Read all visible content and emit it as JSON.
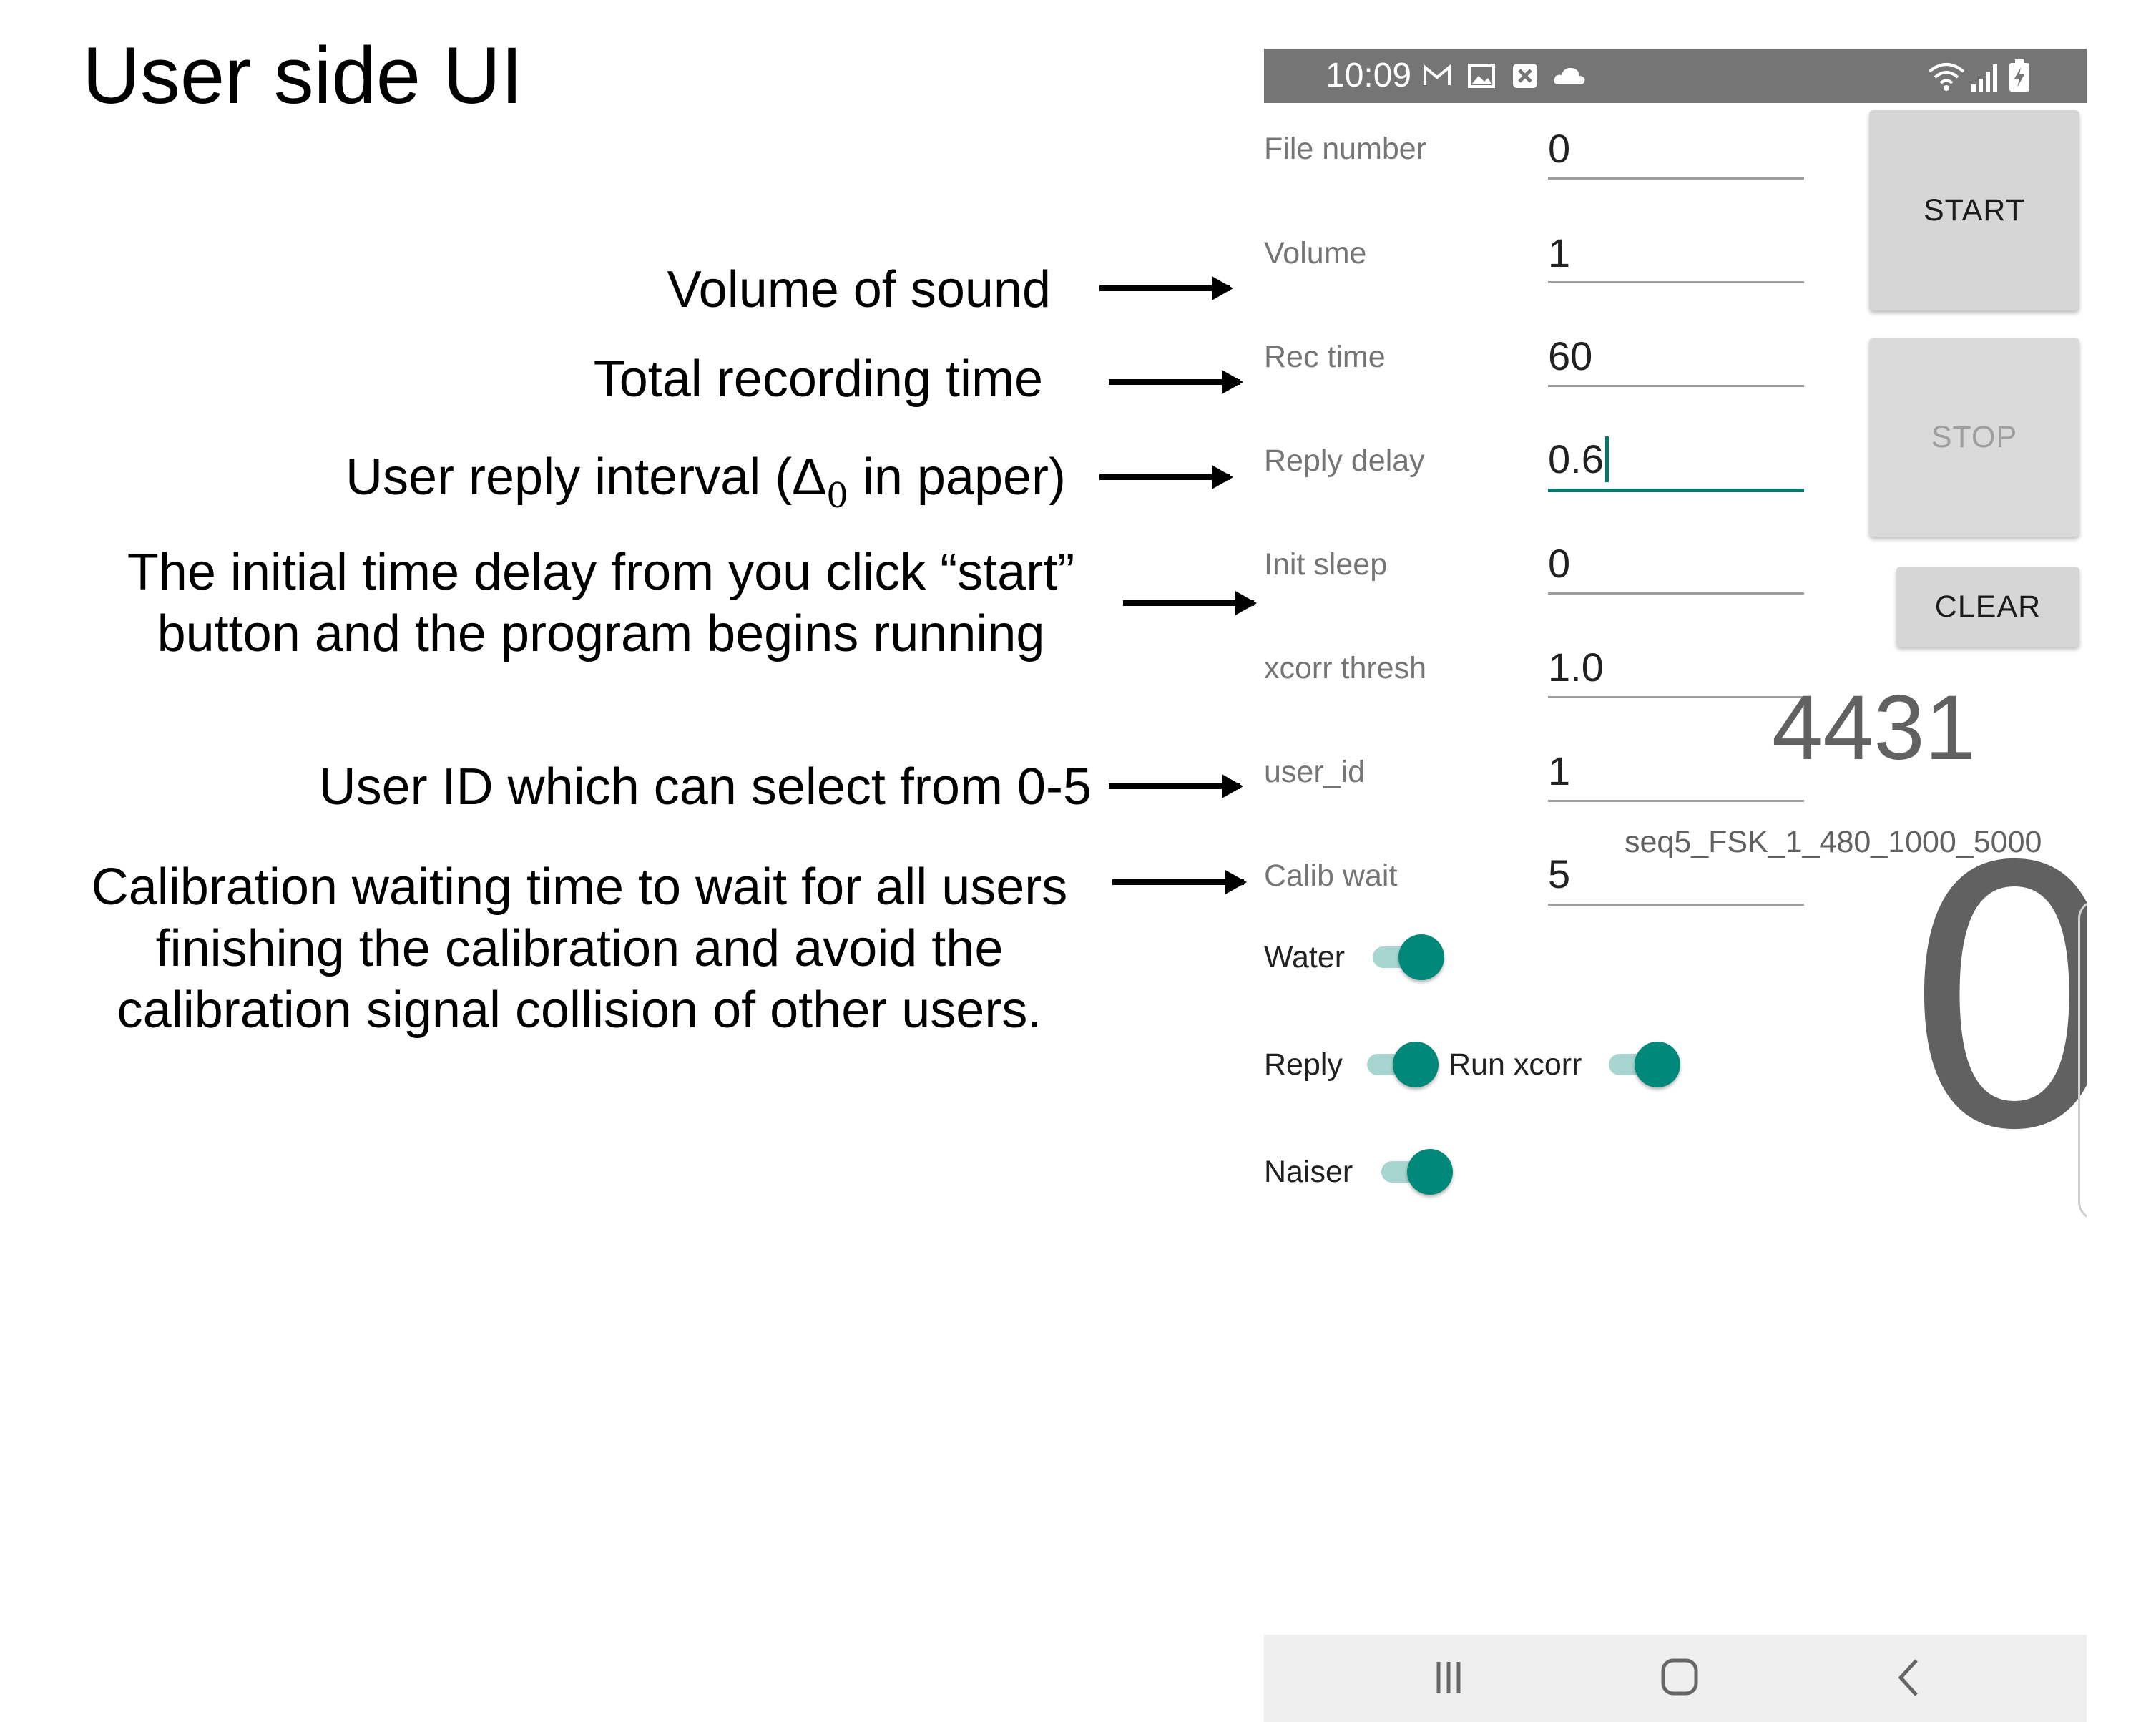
{
  "slide": {
    "title": "User side UI"
  },
  "annotations": {
    "volume": "Volume of sound",
    "rec_time": "Total recording time",
    "reply_delay_pre": "User reply interval (Δ",
    "reply_delay_sub": "0",
    "reply_delay_post": " in paper)",
    "init_sleep_line1": "The initial time delay from you click “start”",
    "init_sleep_line2": "button and the program begins running",
    "user_id": "User ID which can select from 0-5",
    "calib_line1": "Calibration waiting time to wait for all users",
    "calib_line2": "finishing the calibration and avoid the",
    "calib_line3": "calibration signal collision of other users."
  },
  "statusbar": {
    "time": "10:09",
    "left_icons": [
      "gmail-icon",
      "image-icon",
      "close-box-icon",
      "cloud-icon"
    ],
    "right_icons": [
      "wifi-icon",
      "signal-icon",
      "battery-charging-icon"
    ]
  },
  "fields": [
    {
      "label": "File number",
      "value": "0"
    },
    {
      "label": "Volume",
      "value": "1"
    },
    {
      "label": "Rec time",
      "value": "60"
    },
    {
      "label": "Reply delay",
      "value": "0.6"
    },
    {
      "label": "Init sleep",
      "value": "0"
    },
    {
      "label": "xcorr thresh",
      "value": "1.0"
    },
    {
      "label": "user_id",
      "value": "1"
    },
    {
      "label": "Calib wait",
      "value": "5"
    }
  ],
  "buttons": {
    "start": "START",
    "stop": "STOP",
    "clear": "CLEAR"
  },
  "status": {
    "count": "4431",
    "sequence": "seq5_FSK_1_480_1000_5000",
    "big_number": "0"
  },
  "switches": {
    "water": {
      "label": "Water",
      "on": true
    },
    "reply": {
      "label": "Reply",
      "on": true
    },
    "run_xcorr": {
      "label": "Run xcorr",
      "on": true
    },
    "naiser": {
      "label": "Naiser",
      "on": true
    }
  },
  "colors": {
    "accent": "#00897b",
    "statusbar": "#757575",
    "button": "#d6d6d6"
  },
  "navbar": {
    "icons": [
      "recent-apps-icon",
      "home-icon",
      "back-icon"
    ]
  }
}
